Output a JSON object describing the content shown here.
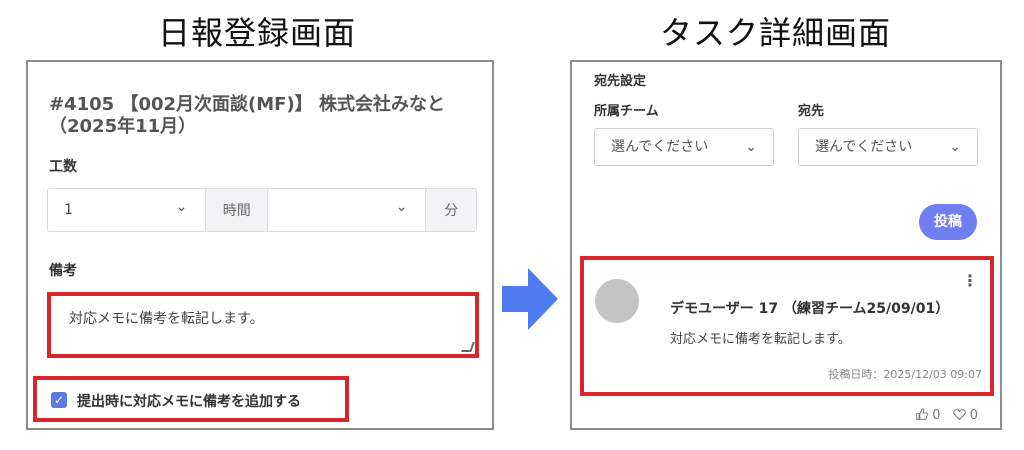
{
  "captions": {
    "left": "日報登録画面",
    "right": "タスク詳細画面"
  },
  "report": {
    "title": "#4105 【002月次面談(MF)】 株式会社みなと（2025年11月）",
    "work_label": "工数",
    "hours_value": "1",
    "hours_unit": "時間",
    "minutes_value": "",
    "minutes_unit": "分",
    "note_label": "備考",
    "note_text": "対応メモに備考を転記します。",
    "checkbox_label": "提出時に対応メモに備考を追加する",
    "checkbox_checked": true
  },
  "task": {
    "dest_section": "宛先設定",
    "team_label": "所属チーム",
    "team_placeholder": "選んでください",
    "dest_label": "宛先",
    "dest_placeholder": "選んでください",
    "post_button": "投稿",
    "post": {
      "author": "デモユーザー 17 （練習チーム25/09/01）",
      "body": "対応メモに備考を転記します。",
      "time": "投稿日時：2025/12/03 09:07"
    },
    "likes": "0",
    "hearts": "0"
  },
  "colors": {
    "highlight": "#d9262c",
    "accent": "#6f7ef0",
    "arrow": "#4f7cf0"
  },
  "icons": {
    "dropdown": "chevron-down-icon",
    "like": "thumbs-up-icon",
    "heart": "heart-icon",
    "menu": "more-vertical-icon"
  }
}
